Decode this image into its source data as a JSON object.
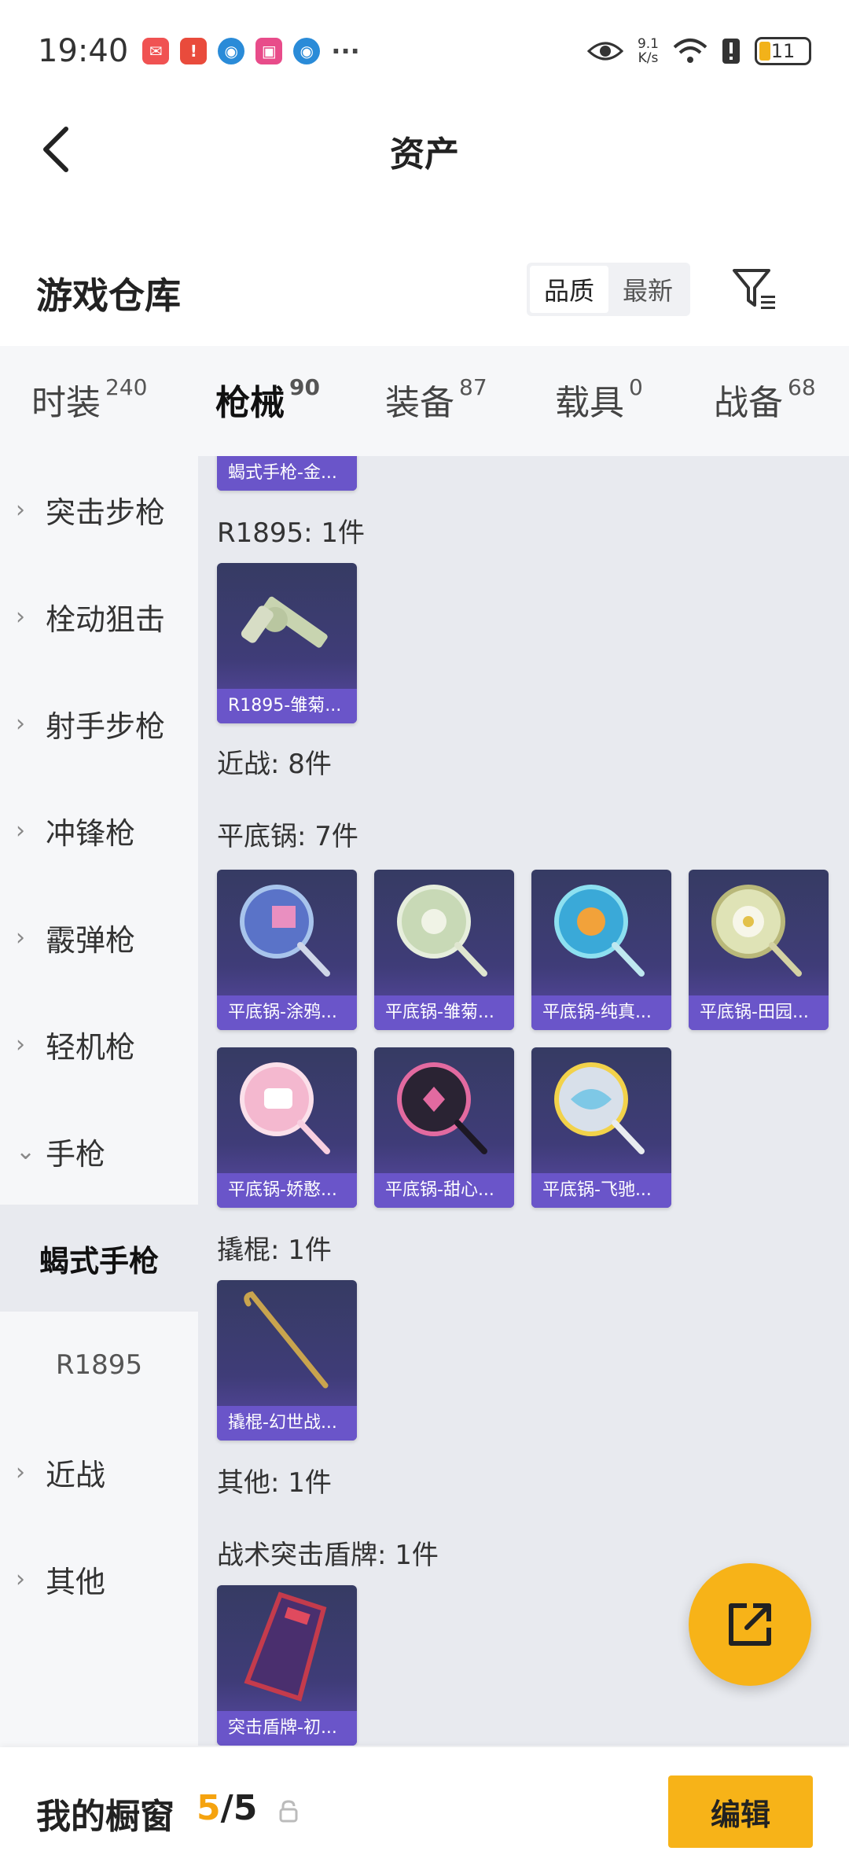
{
  "status_bar": {
    "time": "19:40",
    "speed_value": "9.1",
    "speed_unit": "K/s",
    "battery": "11"
  },
  "header": {
    "title": "资产"
  },
  "warehouse": {
    "title": "游戏仓库",
    "sort_quality": "品质",
    "sort_newest": "最新"
  },
  "tabs": [
    {
      "label": "时装",
      "count": "240"
    },
    {
      "label": "枪械",
      "count": "90"
    },
    {
      "label": "装备",
      "count": "87"
    },
    {
      "label": "载具",
      "count": "0"
    },
    {
      "label": "战备",
      "count": "68"
    }
  ],
  "sidebar": {
    "items": [
      {
        "label": "突击步枪"
      },
      {
        "label": "栓动狙击"
      },
      {
        "label": "射手步枪"
      },
      {
        "label": "冲锋枪"
      },
      {
        "label": "霰弹枪"
      },
      {
        "label": "轻机枪"
      },
      {
        "label": "手枪"
      },
      {
        "label": "蝎式手枪"
      },
      {
        "label": "R1895"
      },
      {
        "label": "近战"
      },
      {
        "label": "其他"
      }
    ]
  },
  "content": {
    "top_partial_card": "蝎式手枪-金...",
    "sections": [
      {
        "label": "R1895: 1件"
      },
      {
        "label": "近战: 8件"
      },
      {
        "label": "平底锅: 7件"
      },
      {
        "label": "撬棍: 1件"
      },
      {
        "label": "其他: 1件"
      },
      {
        "label": "战术突击盾牌: 1件"
      }
    ],
    "cards": [
      {
        "name": "R1895-雏菊..."
      },
      {
        "name": "平底锅-涂鸦..."
      },
      {
        "name": "平底锅-雏菊..."
      },
      {
        "name": "平底锅-纯真..."
      },
      {
        "name": "平底锅-田园..."
      },
      {
        "name": "平底锅-娇憨..."
      },
      {
        "name": "平底锅-甜心..."
      },
      {
        "name": "平底锅-飞驰..."
      },
      {
        "name": "撬棍-幻世战..."
      },
      {
        "name": "突击盾牌-初..."
      }
    ]
  },
  "bottom_bar": {
    "label": "我的橱窗",
    "current": "5",
    "total": "/5",
    "edit_label": "编辑"
  },
  "colors": {
    "accent": "#f7b318",
    "card_label_bg": "#6a55c9"
  }
}
